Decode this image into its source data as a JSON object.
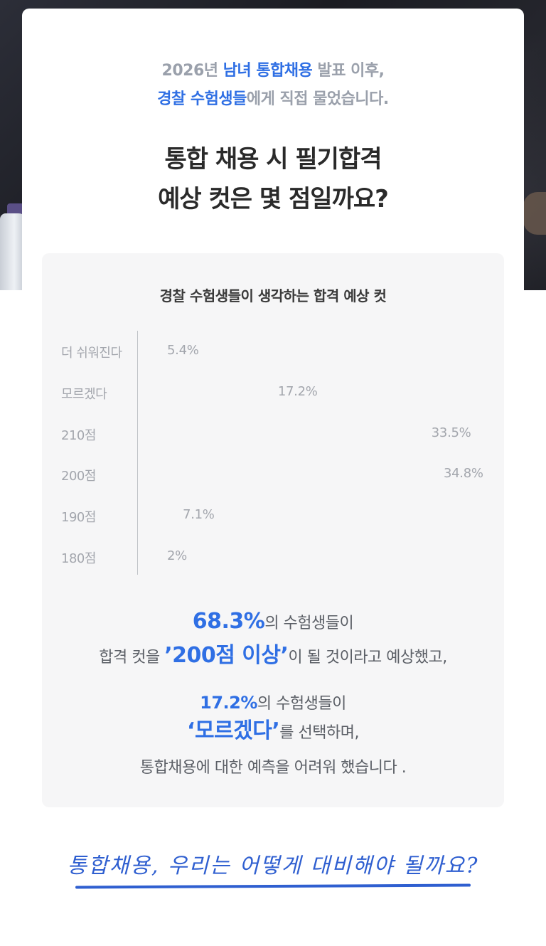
{
  "intro": {
    "line1_prefix": "2026년 ",
    "line1_highlight": "남녀 통합채용",
    "line1_suffix": " 발표 이후,",
    "line2_highlight": "경찰 수험생들",
    "line2_suffix": "에게 직접 물었습니다."
  },
  "headline": {
    "line1": "통합 채용 시 필기합격",
    "line2": "예상 컷은 몇 점일까요?"
  },
  "chart_data": {
    "type": "bar",
    "title": "경찰 수험생들이 생각하는 합격 예상 컷",
    "categories": [
      "더 쉬워진다",
      "모르겠다",
      "210점",
      "200점",
      "190점",
      "180점"
    ],
    "values": [
      5.4,
      17.2,
      33.5,
      34.8,
      7.1,
      2
    ],
    "value_labels": [
      "5.4%",
      "17.2%",
      "33.5%",
      "34.8%",
      "7.1%",
      "2%"
    ],
    "orientation": "horizontal",
    "xlim": [
      0,
      34.8
    ]
  },
  "summary": {
    "s1_big": "68.3%",
    "s1_text": "의 수험생들이",
    "s2_prefix": "합격 컷을 ",
    "s2_big": "’200점 이상’",
    "s2_suffix": "이 될 것이라고 예상했고,",
    "s3_mid": "17.2%",
    "s3_text": "의 수험생들이",
    "s4_big": "‘모르겠다’",
    "s4_suffix": "를 선택하며,",
    "s5_text": "통합채용에 대한 예측을 어려워 했습니다 ."
  },
  "closing": {
    "text": "통합채용, 우리는 어떻게 대비해야 될까요?"
  },
  "colors": {
    "accent": "#2f6fe4",
    "panel_bg": "#f6f6f7",
    "muted_text": "#a3a6ad"
  }
}
